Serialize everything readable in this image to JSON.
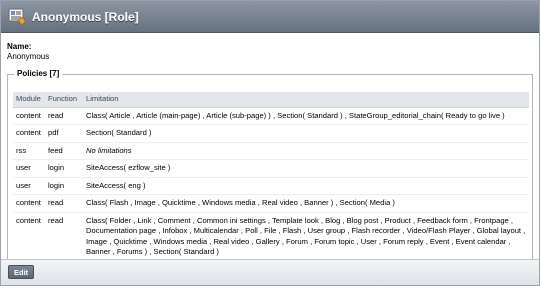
{
  "header": {
    "title": "Anonymous [Role]",
    "icon": "role-icon"
  },
  "details": {
    "name_label": "Name:",
    "name_value": "Anonymous"
  },
  "policies": {
    "legend": "Policies [7]",
    "columns": [
      "Module",
      "Function",
      "Limitation"
    ],
    "rows": [
      {
        "module": "content",
        "function": "read",
        "limitation": "Class( Article , Article (main-page) , Article (sub-page) ) , Section( Standard ) , StateGroup_editorial_chain( Ready to go live )"
      },
      {
        "module": "content",
        "function": "pdf",
        "limitation": "Section( Standard )"
      },
      {
        "module": "rss",
        "function": "feed",
        "limitation": "No limitations"
      },
      {
        "module": "user",
        "function": "login",
        "limitation": "SiteAccess( ezflow_site )"
      },
      {
        "module": "user",
        "function": "login",
        "limitation": "SiteAccess( eng )"
      },
      {
        "module": "content",
        "function": "read",
        "limitation": "Class( Flash , Image , Quicktime , Windows media , Real video , Banner ) , Section( Media )"
      },
      {
        "module": "content",
        "function": "read",
        "limitation": "Class( Folder , Link , Comment , Common ini settings , Template look , Blog , Blog post , Product , Feedback form , Frontpage , Documentation page , Infobox , Multicalendar , Poll , File , Flash , User group , Flash recorder , Video/Flash Player , Global layout , Image , Quicktime , Windows media , Real video , Gallery , Forum , Forum topic , User , Forum reply , Event , Event calendar , Banner , Forums ) , Section( Standard )"
      }
    ]
  },
  "footer": {
    "edit_label": "Edit"
  }
}
